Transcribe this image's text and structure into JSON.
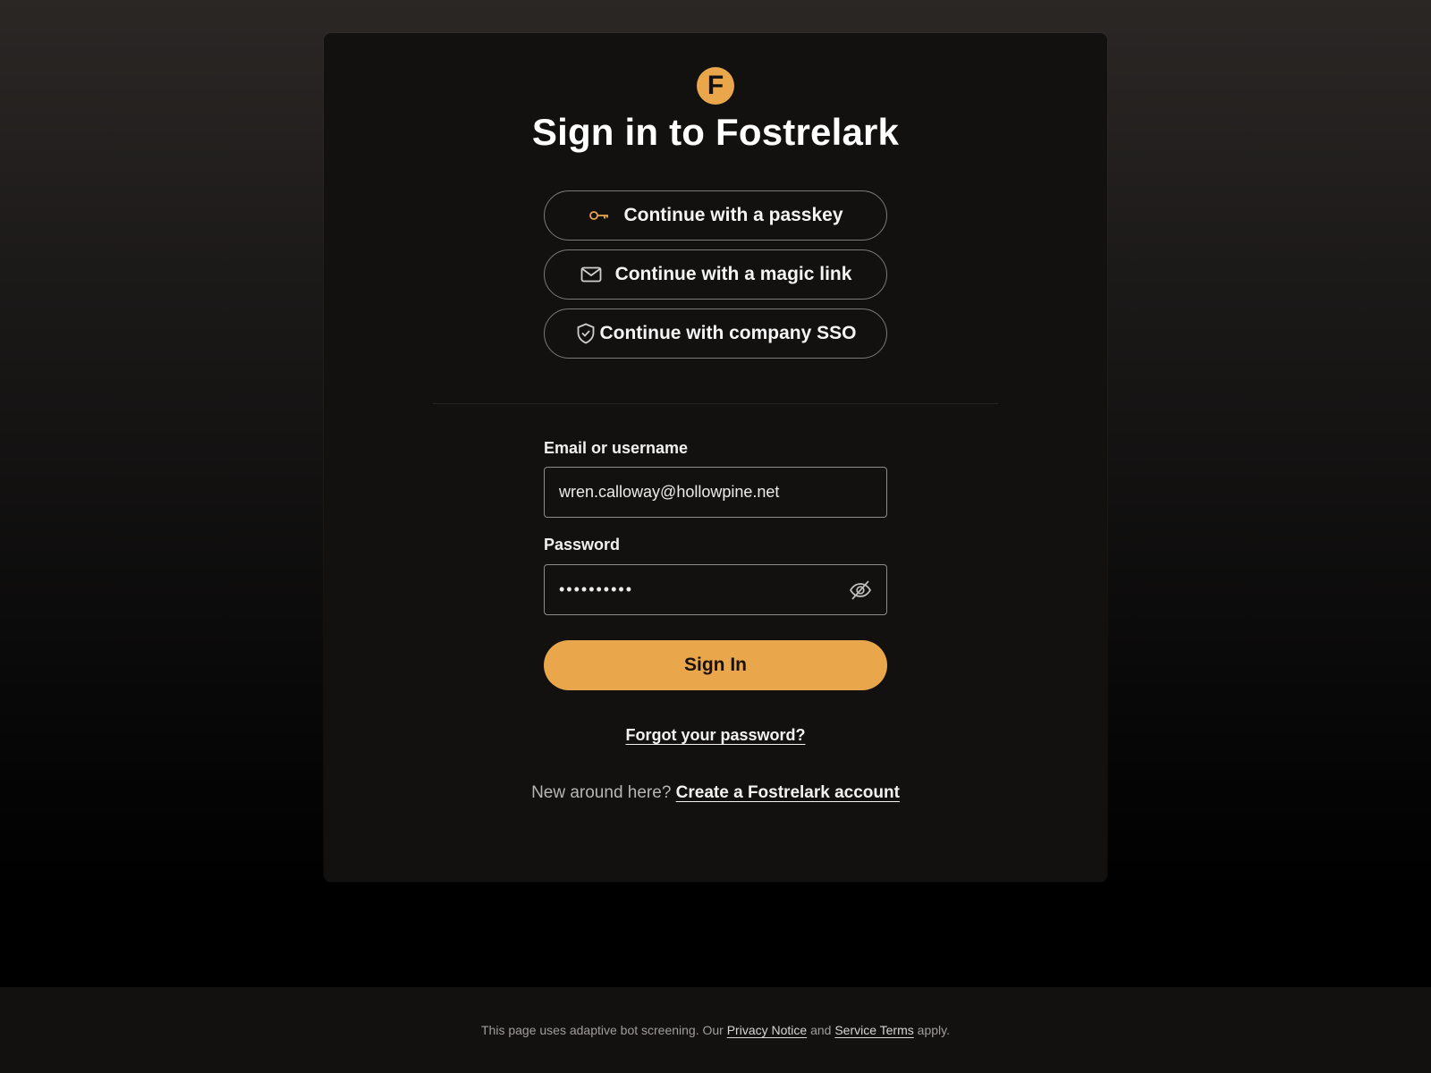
{
  "brand": {
    "logo_letter": "F",
    "accent_color": "#e9a64b"
  },
  "title": "Sign in to Fostrelark",
  "alt_methods": [
    {
      "label": "Continue with a passkey",
      "icon": "key-icon"
    },
    {
      "label": "Continue with a magic link",
      "icon": "mail-icon"
    },
    {
      "label": "Continue with company SSO",
      "icon": "shield-check-icon"
    }
  ],
  "form": {
    "email_label": "Email or username",
    "email_value": "wren.calloway@hollowpine.net",
    "password_label": "Password",
    "password_value": "••••••••••",
    "password_toggle_icon": "eye-off-icon",
    "submit_label": "Sign In"
  },
  "links": {
    "forgot": "Forgot your password?",
    "new_prompt": "New around here?",
    "create_account": "Create a Fostrelark account"
  },
  "footer": {
    "prefix": "This page uses adaptive bot screening. Our",
    "privacy": "Privacy Notice",
    "and": "and",
    "terms": "Service Terms",
    "suffix": "apply."
  }
}
